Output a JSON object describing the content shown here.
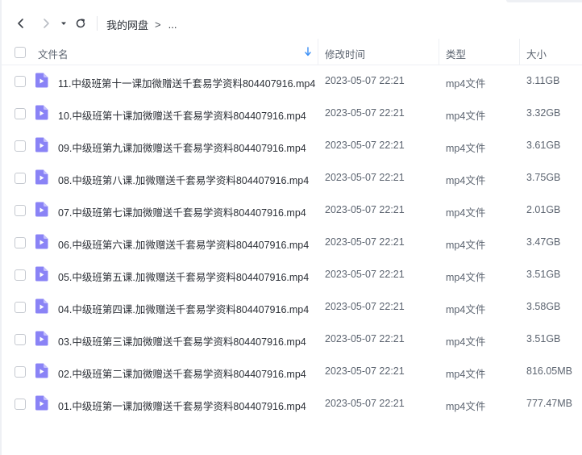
{
  "toolbar": {
    "back_icon": "arrow-left-icon",
    "forward_icon": "arrow-right-icon",
    "history_icon": "caret-down-icon",
    "refresh_icon": "refresh-icon"
  },
  "breadcrumb": {
    "root": "我的网盘",
    "separator": ">",
    "more": "..."
  },
  "columns": {
    "name": "文件名",
    "modified": "修改时间",
    "type": "类型",
    "size": "大小",
    "sort_icon": "sort-down-icon"
  },
  "colors": {
    "accent": "#3b8ff6",
    "file_icon": "#8a83f6"
  },
  "files": [
    {
      "name": "11.中级班第十一课加微赠送千套易学资料804407916.mp4",
      "modified": "2023-05-07 22:21",
      "type": "mp4文件",
      "size": "3.11GB"
    },
    {
      "name": "10.中级班第十课加微赠送千套易学资料804407916.mp4",
      "modified": "2023-05-07 22:21",
      "type": "mp4文件",
      "size": "3.32GB"
    },
    {
      "name": "09.中级班第九课加微赠送千套易学资料804407916.mp4",
      "modified": "2023-05-07 22:21",
      "type": "mp4文件",
      "size": "3.61GB"
    },
    {
      "name": "08.中级班第八课.加微赠送千套易学资料804407916.mp4",
      "modified": "2023-05-07 22:21",
      "type": "mp4文件",
      "size": "3.75GB"
    },
    {
      "name": "07.中级班第七课加微赠送千套易学资料804407916.mp4",
      "modified": "2023-05-07 22:21",
      "type": "mp4文件",
      "size": "2.01GB"
    },
    {
      "name": "06.中级班第六课.加微赠送千套易学资料804407916.mp4",
      "modified": "2023-05-07 22:21",
      "type": "mp4文件",
      "size": "3.47GB"
    },
    {
      "name": "05.中级班第五课.加微赠送千套易学资料804407916.mp4",
      "modified": "2023-05-07 22:21",
      "type": "mp4文件",
      "size": "3.51GB"
    },
    {
      "name": "04.中级班第四课.加微赠送千套易学资料804407916.mp4",
      "modified": "2023-05-07 22:21",
      "type": "mp4文件",
      "size": "3.58GB"
    },
    {
      "name": "03.中级班第三课加微赠送千套易学资料804407916.mp4",
      "modified": "2023-05-07 22:21",
      "type": "mp4文件",
      "size": "3.51GB"
    },
    {
      "name": "02.中级班第二课加微赠送千套易学资料804407916.mp4",
      "modified": "2023-05-07 22:21",
      "type": "mp4文件",
      "size": "816.05MB"
    },
    {
      "name": "01.中级班第一课加微赠送千套易学资料804407916.mp4",
      "modified": "2023-05-07 22:21",
      "type": "mp4文件",
      "size": "777.47MB"
    }
  ]
}
